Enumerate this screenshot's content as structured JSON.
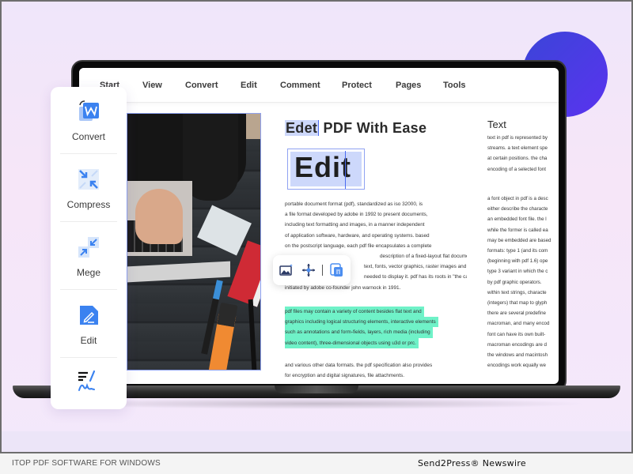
{
  "menubar": {
    "items": [
      "Start",
      "View",
      "Convert",
      "Edit",
      "Comment",
      "Protect",
      "Pages",
      "Tools"
    ]
  },
  "sidebar": {
    "items": [
      {
        "label": "Convert",
        "icon": "convert-word-icon"
      },
      {
        "label": "Compress",
        "icon": "compress-icon"
      },
      {
        "label": "Mege",
        "icon": "merge-icon"
      },
      {
        "label": "Edit",
        "icon": "edit-pencil-icon"
      },
      {
        "label": "",
        "icon": "signature-icon"
      }
    ]
  },
  "document": {
    "title_selected": "Edet",
    "title_rest": " PDF With Ease",
    "edit_word": "Edit",
    "paragraph1": [
      "portable document format (pdf), standardized as iso 32000, is",
      "a file format developed by adobe in 1992 to present documents,",
      "including text formatting and images, in a manner independent",
      "of application software, hardware, and operating systems. based",
      "on the postscript language, each pdf file encapsulates a complete",
      "description of a fixed-layout flat document, including the",
      "text, fonts, vector graphics, raster images and other information",
      "needed to display it. pdf has its roots in \"the camelot project\"",
      "initiated by adobe co-founder john warnock in 1991."
    ],
    "paragraph_highlighted": [
      "pdf files may contain a variety of content besides flat text and",
      "graphics including logical structuring elements, interactive elements",
      "such as annotations and form-fields, layers, rich media (including",
      "video content), three-dimensional objects using u3d or prc."
    ],
    "paragraph3": [
      "and various other data formats. the pdf specification also provides",
      "for encryption and digital signatures, file attachments."
    ],
    "highlight_color": "#6ff2c8",
    "selection_color": "#cdd8fb"
  },
  "side_panel": {
    "title": "Text",
    "paragraph1": [
      "text in pdf is represented by",
      "streams. a text element spe",
      "at certain positions. the cha",
      "encoding of a selected font"
    ],
    "paragraph2": [
      "a font object in pdf is a desc",
      "either describe the characte",
      "an embedded font file. the l",
      "while the former is called ea",
      "may be embedded are based",
      "formats: type 1 (and its com",
      "(beginning with pdf 1.6) ope",
      "type 3 variant in which the c",
      "by pdf graphic operators.",
      "within text strings, characte",
      "(integers) that map to glyph",
      "there are several predefine",
      "macroman, and many encod",
      "font can have its own built-",
      "macroman encodings are d",
      "the windows and macintosh",
      "encodings work equally we"
    ]
  },
  "floating_toolbar": {
    "icons": [
      "image-ai-icon",
      "move-icon",
      "separator",
      "delete-copy-icon"
    ]
  },
  "footer": {
    "left": "ITOP PDF SOFTWARE FOR WINDOWS",
    "right": "Send2Press® Newswire"
  },
  "colors": {
    "accent_blue": "#3b82f0",
    "blob_gradient_start": "#3b45d8",
    "blob_gradient_end": "#5a33ef"
  }
}
